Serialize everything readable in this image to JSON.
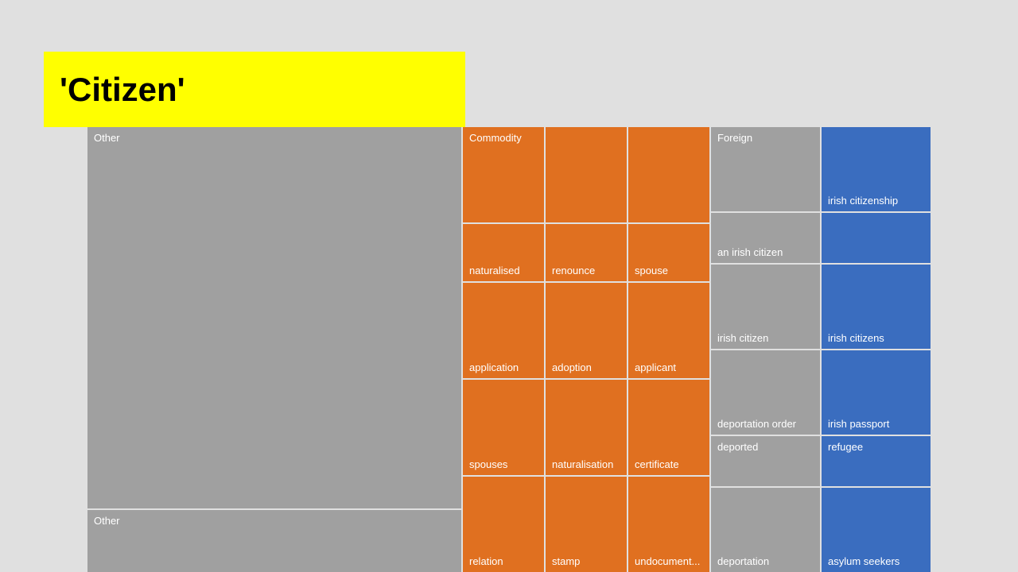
{
  "header": {
    "title": "'Citizen'"
  },
  "treemap": {
    "left": {
      "top_label": "Other",
      "bottom_label": "Other"
    },
    "middle": {
      "rows": [
        [
          "Commodity",
          "",
          ""
        ],
        [
          "naturalised",
          "renounce",
          "spouse"
        ],
        [
          "application",
          "adoption",
          "applicant"
        ],
        [
          "spouses",
          "naturalisation",
          "certificate"
        ],
        [
          "relation",
          "stamp",
          "undocument..."
        ]
      ]
    },
    "right": {
      "rows": [
        [
          "Foreign",
          "irish citizenship"
        ],
        [
          "an irish citizen",
          ""
        ],
        [
          "irish citizen",
          "irish citizens"
        ],
        [
          "deportation order",
          "irish passport"
        ],
        [
          "",
          "refugee"
        ],
        [
          "deported",
          ""
        ],
        [
          "deportation",
          "asylum seekers"
        ]
      ]
    }
  }
}
